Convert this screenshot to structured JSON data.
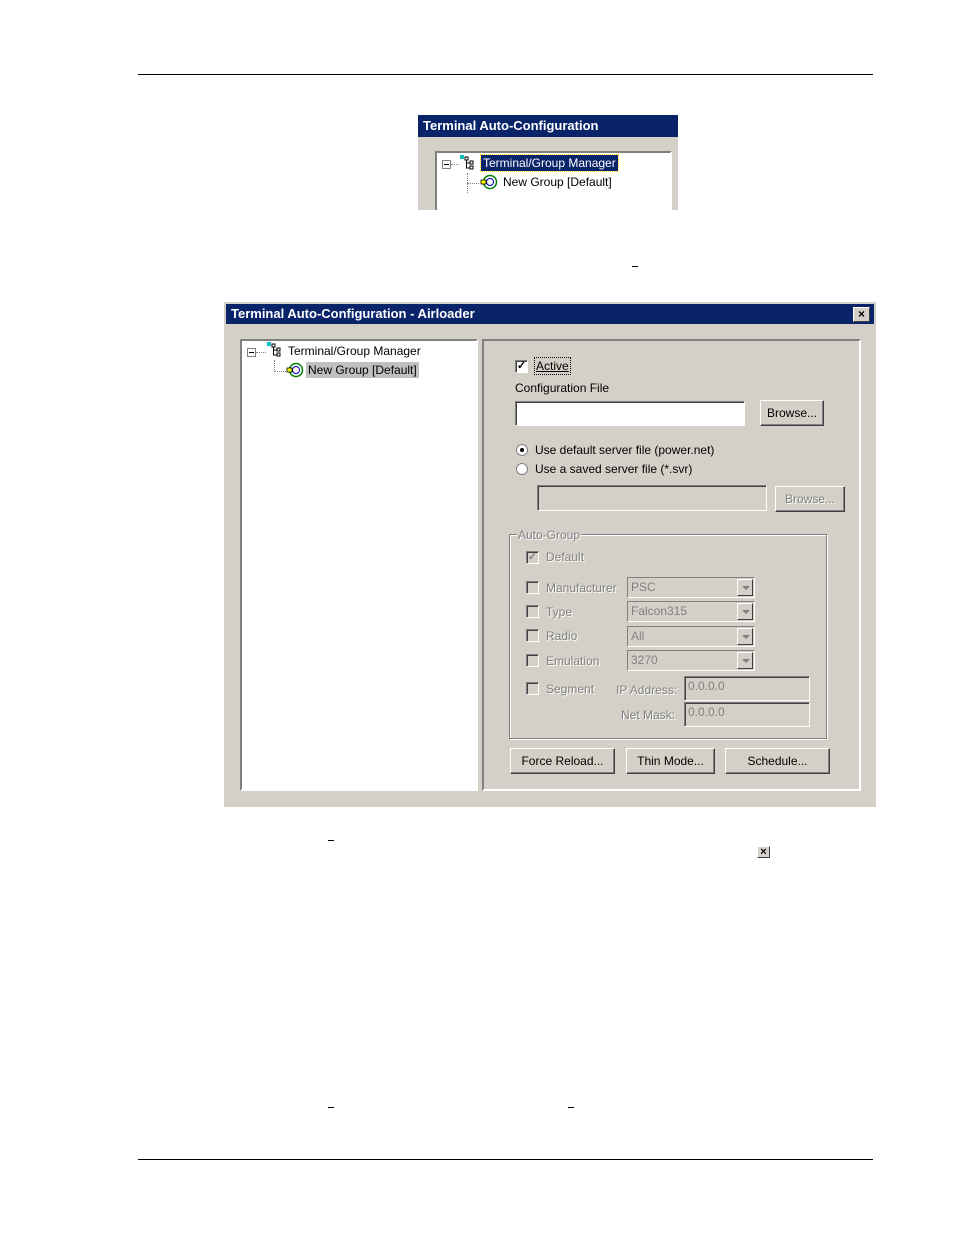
{
  "small_window": {
    "title": "Terminal Auto-Configuration",
    "tree": {
      "root_label": "Terminal/Group Manager",
      "child_label": "New Group [Default]"
    }
  },
  "dialog": {
    "title": "Terminal Auto-Configuration - Airloader",
    "close_glyph": "×",
    "tree": {
      "root_label": "Terminal/Group Manager",
      "child_label": "New Group [Default]"
    },
    "active": {
      "label": "Active",
      "checked": true
    },
    "config_file": {
      "label": "Configuration File",
      "value": "",
      "browse_label": "Browse..."
    },
    "server_file": {
      "option_default": "Use default server file (power.net)",
      "option_saved": "Use a saved server file (*.svr)",
      "selected": "default",
      "saved_path": "",
      "browse_label": "Browse..."
    },
    "auto_group": {
      "title": "Auto-Group",
      "default": {
        "label": "Default",
        "checked": true
      },
      "manufacturer": {
        "label": "Manufacturer",
        "value": "PSC"
      },
      "type": {
        "label": "Type",
        "value": "Falcon315"
      },
      "radio": {
        "label": "Radio",
        "value": "All"
      },
      "emulation": {
        "label": "Emulation",
        "value": "3270"
      },
      "segment": {
        "label": "Segment"
      },
      "ip_address": {
        "label": "IP Address:",
        "value": "0.0.0.0"
      },
      "net_mask": {
        "label": "Net Mask:",
        "value": "0.0.0.0"
      }
    },
    "buttons": {
      "force_reload": "Force Reload...",
      "thin_mode": "Thin Mode...",
      "schedule": "Schedule..."
    }
  },
  "inline_close_glyph": "×"
}
